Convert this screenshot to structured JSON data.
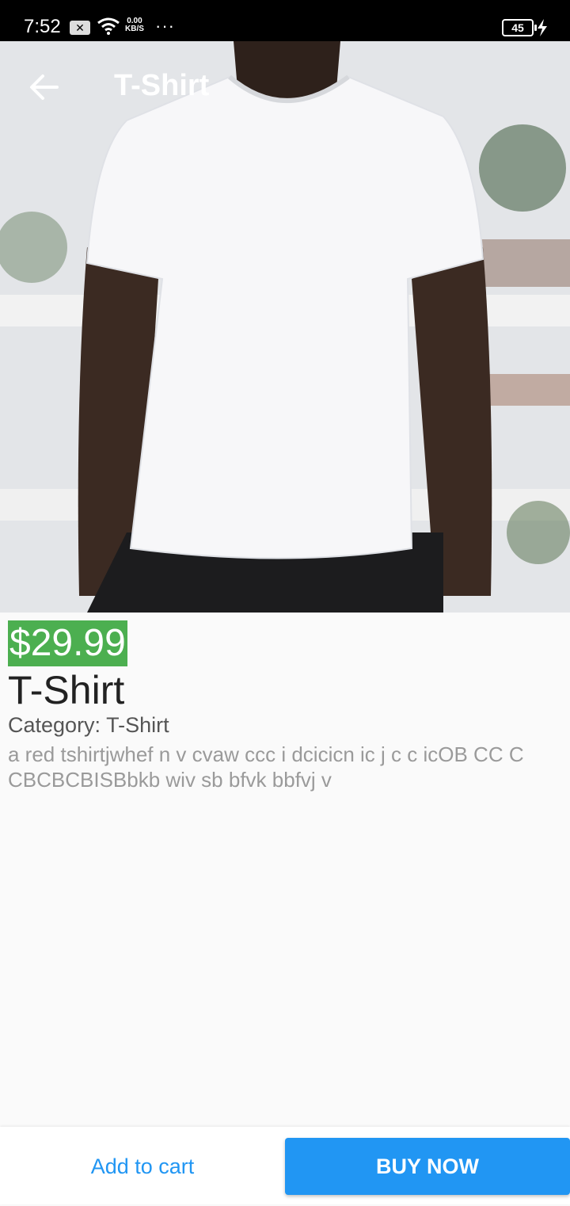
{
  "status_bar": {
    "time": "7:52",
    "notification_icon": "x-square-icon",
    "network_speed_value": "0.00",
    "network_speed_unit": "KB/S",
    "more": "···",
    "battery_level": "45"
  },
  "app_bar": {
    "title": "T-Shirt",
    "back_icon": "arrow-left-icon"
  },
  "product": {
    "image": "white-tshirt-photo",
    "price": "$29.99",
    "name": "T-Shirt",
    "category": "Category: T-Shirt",
    "description": "a red tshirtjwhef n  v cvaw ccc i dcicicn ic j c c icOB CC C    CBCBCBISBbkb wiv sb bfvk bbfvj v"
  },
  "actions": {
    "add_to_cart": "Add to cart",
    "buy_now": "BUY NOW"
  },
  "colors": {
    "price_bg": "#4caf50",
    "accent": "#2196f3",
    "status_bar": "#000000"
  }
}
